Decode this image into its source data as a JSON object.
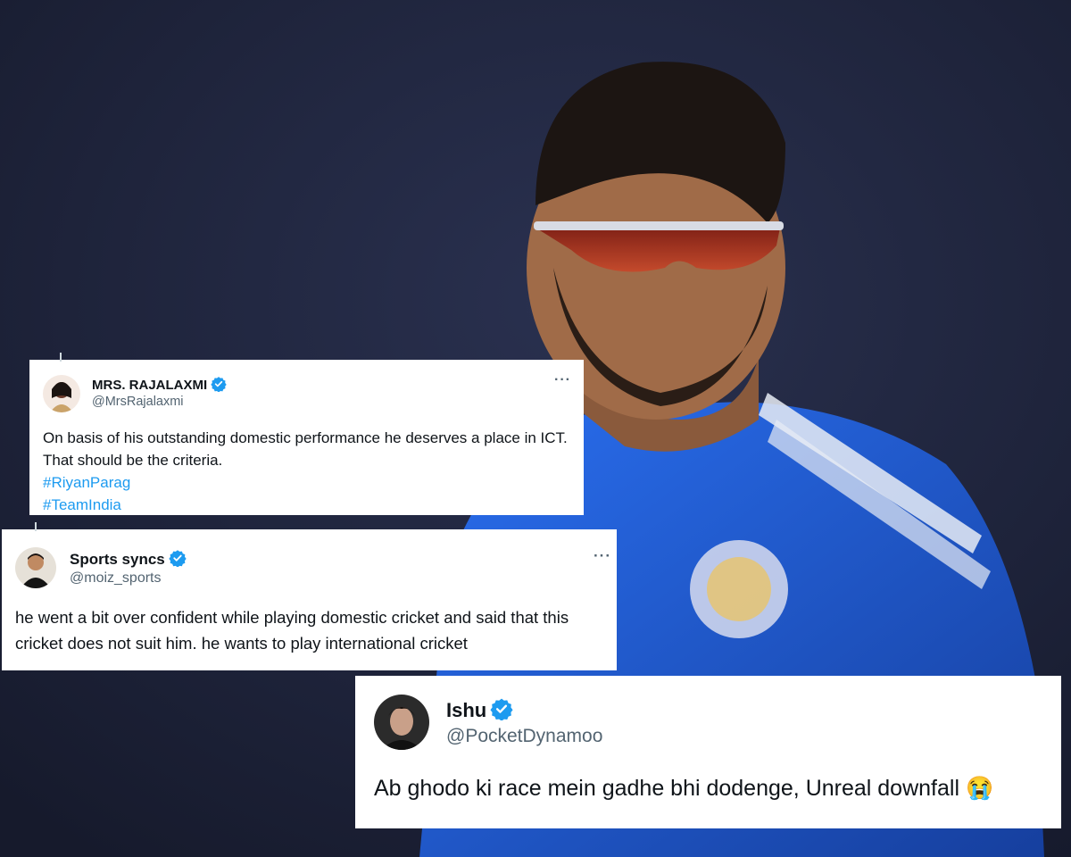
{
  "background": {
    "description_color": "#1b2035",
    "jersey_color": "#1e5bd6"
  },
  "tweets": [
    {
      "name": "MRS. RAJALAXMI",
      "handle": "@MrsRajalaxmi",
      "verified": true,
      "more": "···",
      "text": "On basis of his outstanding domestic performance he deserves a place in ICT. That should be the criteria.",
      "hashtags": [
        "#RiyanParag",
        "#TeamIndia"
      ]
    },
    {
      "name": "Sports syncs",
      "handle": "@moiz_sports",
      "verified": true,
      "more": "···",
      "text": "he went a bit over confident while playing domestic cricket and said that this cricket does not suit him. he wants to play international cricket"
    },
    {
      "name": "Ishu",
      "handle": "@PocketDynamoo",
      "verified": true,
      "text": "Ab ghodo ki race mein gadhe bhi dodenge, Unreal downfall",
      "emoji": "😭"
    }
  ],
  "colors": {
    "accent": "#1d9bf0",
    "handle": "#536471",
    "text": "#0f1419"
  }
}
